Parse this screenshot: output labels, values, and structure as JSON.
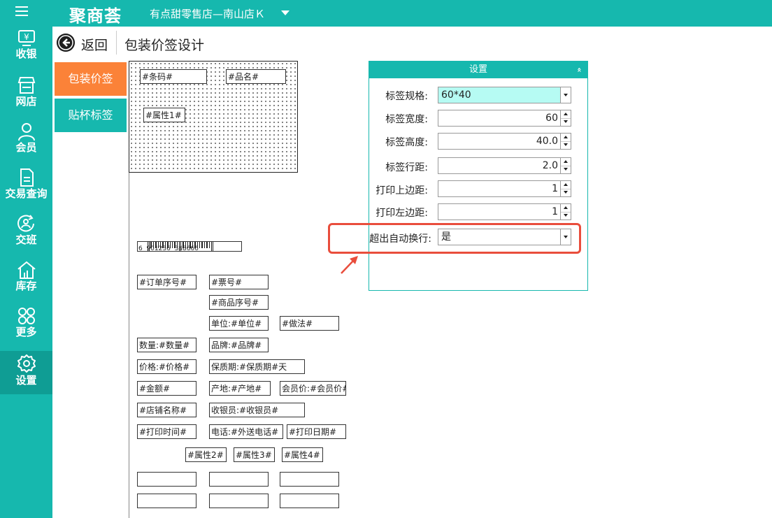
{
  "topbar": {
    "logo": "聚商荟",
    "store": "有点甜零售店—南山店Ｋ"
  },
  "sidebar": {
    "items": [
      {
        "label": "收银",
        "icon": "cashier-icon"
      },
      {
        "label": "网店",
        "icon": "store-icon"
      },
      {
        "label": "会员",
        "icon": "member-icon"
      },
      {
        "label": "交易查询",
        "icon": "transaction-icon"
      },
      {
        "label": "交班",
        "icon": "shift-icon"
      },
      {
        "label": "库存",
        "icon": "inventory-icon"
      },
      {
        "label": "更多",
        "icon": "more-icon"
      },
      {
        "label": "设置",
        "icon": "settings-icon",
        "active": true
      }
    ]
  },
  "header": {
    "back_label": "返回",
    "title": "包装价签设计"
  },
  "tabs": [
    {
      "label": "包装价签",
      "active": true
    },
    {
      "label": "贴杯标签",
      "active": false
    }
  ],
  "label_fields": {
    "barcode": "#条码#",
    "name": "#品名#",
    "attr1": "#属性1#"
  },
  "barcode_text": "6  901236  348666",
  "palette": [
    "#订单序号#",
    "#票号#",
    "#商品序号#",
    "单位:#单位#",
    "#做法#",
    "数量:#数量#",
    "品牌:#品牌#",
    "价格:#价格#",
    "保质期:#保质期#天",
    "#金额#",
    "产地:#产地#",
    "会员价:#会员价#",
    "#店铺名称#",
    "收银员:#收银员#",
    "#打印时间#",
    "电话:#外送电话#",
    "#打印日期#",
    "#属性2#",
    "#属性3#",
    "#属性4#"
  ],
  "settings": {
    "title": "设置",
    "collapse": "»",
    "spec_label": "标签规格:",
    "spec_value": "60*40",
    "width_label": "标签宽度:",
    "width_value": "60",
    "height_label": "标签高度:",
    "height_value": "40.0",
    "spacing_label": "标签行距:",
    "spacing_value": "2.0",
    "top_margin_label": "打印上边距:",
    "top_margin_value": "1",
    "left_margin_label": "打印左边距:",
    "left_margin_value": "1",
    "wrap_label": "超出自动换行:",
    "wrap_value": "是"
  },
  "colors": {
    "accent": "#16b8ae",
    "active_tab": "#fb8238",
    "highlight": "#e94d3c",
    "spec_select_bg": "#b6fbf3"
  }
}
